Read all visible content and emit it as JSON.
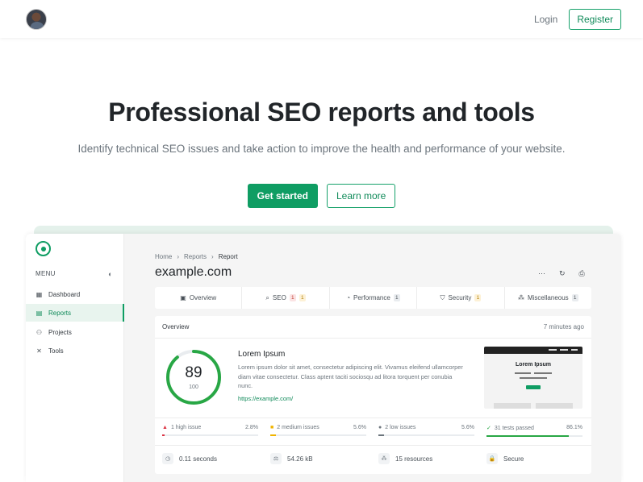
{
  "nav": {
    "login": "Login",
    "register": "Register"
  },
  "hero": {
    "title": "Professional SEO reports and tools",
    "subtitle": "Identify technical SEO issues and take action to improve the health and performance of your website.",
    "primary_cta": "Get started",
    "secondary_cta": "Learn more"
  },
  "app": {
    "sidebar": {
      "menu_label": "MENU",
      "items": [
        {
          "label": "Dashboard",
          "icon": "grid-icon",
          "active": false
        },
        {
          "label": "Reports",
          "icon": "report-icon",
          "active": true
        },
        {
          "label": "Projects",
          "icon": "projects-icon",
          "active": false
        },
        {
          "label": "Tools",
          "icon": "tools-icon",
          "active": false
        }
      ]
    },
    "breadcrumb": [
      "Home",
      "Reports",
      "Report"
    ],
    "page_title": "example.com",
    "tabs": [
      {
        "label": "Overview",
        "badges": []
      },
      {
        "label": "SEO",
        "badges": [
          {
            "text": "1",
            "tone": "red"
          },
          {
            "text": "1",
            "tone": "yellow"
          }
        ]
      },
      {
        "label": "Performance",
        "badges": [
          {
            "text": "1",
            "tone": "grey"
          }
        ]
      },
      {
        "label": "Security",
        "badges": [
          {
            "text": "1",
            "tone": "yellow"
          }
        ]
      },
      {
        "label": "Miscellaneous",
        "badges": [
          {
            "text": "1",
            "tone": "grey"
          }
        ]
      }
    ],
    "overview": {
      "header": "Overview",
      "time": "7 minutes ago",
      "score": "89",
      "score_max": "100",
      "score_fraction": 0.89,
      "site_title": "Lorem Ipsum",
      "description": "Lorem ipsum dolor sit amet, consectetur adipiscing elit. Vivamus eleifend ullamcorper diam vitae consectetur. Class aptent taciti sociosqu ad litora torquent per conubia nunc.",
      "url": "https://example.com/",
      "thumb_title": "Lorem Ipsum"
    },
    "stats": [
      {
        "label": "1 high issue",
        "percent": "2.8%",
        "fraction": 0.028,
        "color": "#dc3545",
        "marker": "▲"
      },
      {
        "label": "2 medium issues",
        "percent": "5.6%",
        "fraction": 0.056,
        "color": "#f0b400",
        "marker": "■"
      },
      {
        "label": "2 low issues",
        "percent": "5.6%",
        "fraction": 0.056,
        "color": "#6c757d",
        "marker": "●"
      },
      {
        "label": "31 tests passed",
        "percent": "86.1%",
        "fraction": 0.861,
        "color": "#28a745",
        "marker": "✓"
      }
    ],
    "metrics": [
      {
        "label": "0.11 seconds",
        "icon": "clock-icon"
      },
      {
        "label": "54.26 kB",
        "icon": "weight-icon"
      },
      {
        "label": "15 resources",
        "icon": "resources-icon"
      },
      {
        "label": "Secure",
        "icon": "lock-icon"
      }
    ]
  }
}
